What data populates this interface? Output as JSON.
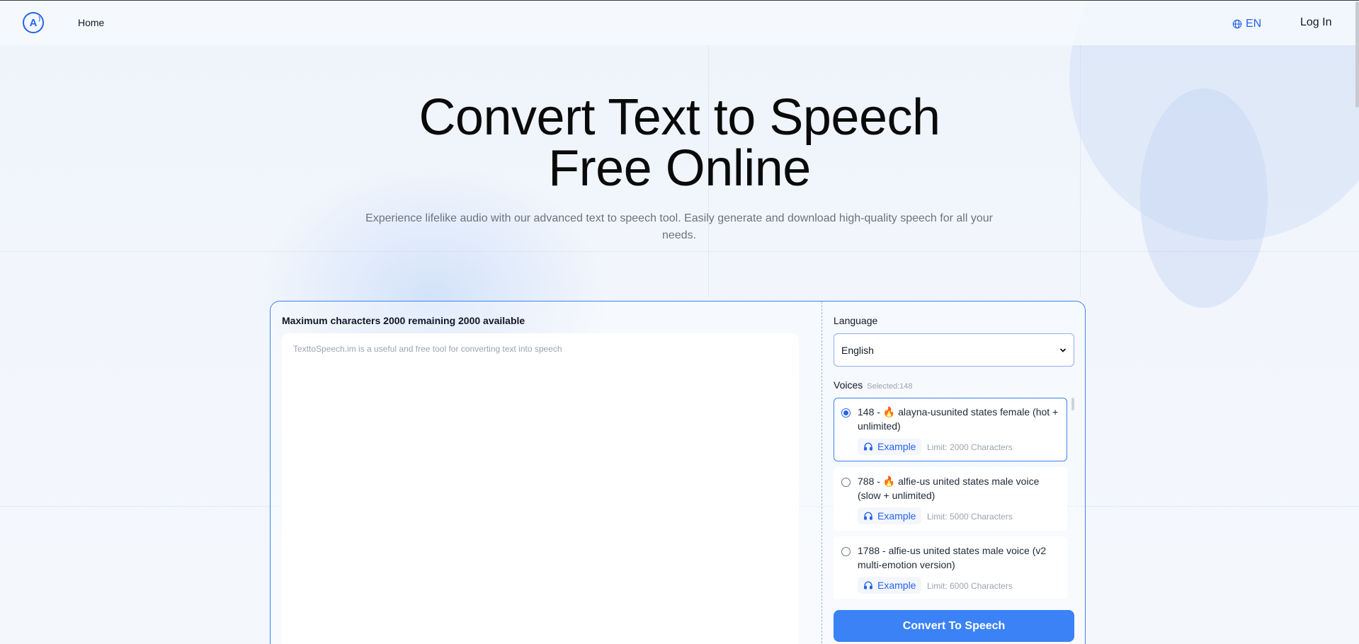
{
  "header": {
    "home_label": "Home",
    "lang_label": "EN",
    "login_label": "Log In"
  },
  "hero": {
    "title_line1": "Convert Text to Speech",
    "title_line2": "Free Online",
    "subtitle": "Experience lifelike audio with our advanced text to speech tool. Easily generate and download high-quality speech for all your needs."
  },
  "editor": {
    "char_info": "Maximum characters 2000 remaining 2000 available",
    "placeholder": "TexttoSpeech.im is a useful and free tool for converting text into speech",
    "value": ""
  },
  "settings": {
    "language_label": "Language",
    "language_value": "English",
    "voices_label": "Voices",
    "voices_selected": "Selected:148",
    "voices": [
      {
        "id": "148",
        "prefix": "148 - ",
        "flame": "🔥",
        "name": "alayna-usunited states female (hot + unlimited)",
        "example_label": "Example",
        "limit": "Limit: 2000 Characters",
        "selected": true
      },
      {
        "id": "788",
        "prefix": "788 - ",
        "flame": "🔥",
        "name": "alfie-us united states male voice (slow + unlimited)",
        "example_label": "Example",
        "limit": "Limit: 5000 Characters",
        "selected": false
      },
      {
        "id": "1788",
        "prefix": "1788 - ",
        "flame": "",
        "name": "alfie-us united states male voice (v2 multi-emotion version)",
        "example_label": "Example",
        "limit": "Limit: 6000 Characters",
        "selected": false
      }
    ],
    "convert_label": "Convert To Speech"
  },
  "icons": {
    "logo": "logo-icon",
    "globe": "globe-icon",
    "headset": "headset-icon",
    "chevron": "chevron-down-icon"
  },
  "colors": {
    "accent": "#3b82f6",
    "flame": "#f97316"
  }
}
